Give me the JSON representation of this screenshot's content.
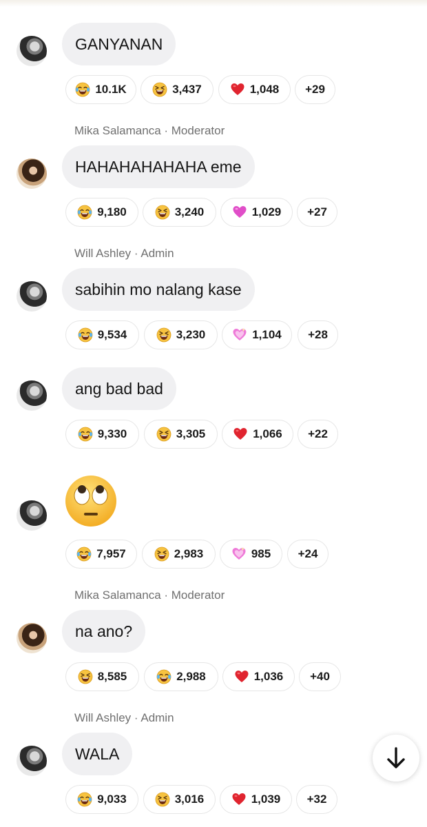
{
  "messages": [
    {
      "sender": "",
      "text": "GANYANAN",
      "avatar": "male",
      "reactions": [
        {
          "icon": "laughing-tears-icon",
          "count": "10.1K"
        },
        {
          "icon": "grinning-squint-icon",
          "count": "3,437"
        },
        {
          "icon": "red-heart-icon",
          "count": "1,048"
        },
        {
          "icon": "",
          "count": "+29"
        }
      ]
    },
    {
      "sender": "Mika Salamanca · Moderator",
      "text": "HAHAHAHAHAHA eme",
      "avatar": "female",
      "reactions": [
        {
          "icon": "laughing-tears-icon",
          "count": "9,180"
        },
        {
          "icon": "grinning-squint-icon",
          "count": "3,240"
        },
        {
          "icon": "pink-heart-icon",
          "count": "1,029"
        },
        {
          "icon": "",
          "count": "+27"
        }
      ]
    },
    {
      "sender": "Will Ashley · Admin",
      "text": "sabihin mo nalang kase",
      "avatar": "male",
      "reactions": [
        {
          "icon": "laughing-tears-icon",
          "count": "9,534"
        },
        {
          "icon": "grinning-squint-icon",
          "count": "3,230"
        },
        {
          "icon": "sparkling-heart-icon",
          "count": "1,104"
        },
        {
          "icon": "",
          "count": "+28"
        }
      ]
    },
    {
      "sender": "",
      "text": "ang bad bad",
      "avatar": "male",
      "reactions": [
        {
          "icon": "laughing-tears-icon",
          "count": "9,330"
        },
        {
          "icon": "grinning-squint-icon",
          "count": "3,305"
        },
        {
          "icon": "red-heart-icon",
          "count": "1,066"
        },
        {
          "icon": "",
          "count": "+22"
        }
      ]
    },
    {
      "sender": "",
      "text": "",
      "emoji": "eye-roll-emoji-icon",
      "avatar": "male",
      "reactions": [
        {
          "icon": "laughing-tears-icon",
          "count": "7,957"
        },
        {
          "icon": "grinning-squint-icon",
          "count": "2,983"
        },
        {
          "icon": "sparkling-heart-icon",
          "count": "985"
        },
        {
          "icon": "",
          "count": "+24"
        }
      ]
    },
    {
      "sender": "Mika Salamanca · Moderator",
      "text": "na ano?",
      "avatar": "female",
      "reactions": [
        {
          "icon": "grinning-squint-icon",
          "count": "8,585"
        },
        {
          "icon": "laughing-tears-icon",
          "count": "2,988"
        },
        {
          "icon": "red-heart-icon",
          "count": "1,036"
        },
        {
          "icon": "",
          "count": "+40"
        }
      ]
    },
    {
      "sender": "Will Ashley · Admin",
      "text": "WALA",
      "avatar": "male",
      "reactions": [
        {
          "icon": "laughing-tears-icon",
          "count": "9,033"
        },
        {
          "icon": "grinning-squint-icon",
          "count": "3,016"
        },
        {
          "icon": "red-heart-icon",
          "count": "1,039"
        },
        {
          "icon": "",
          "count": "+32"
        }
      ]
    }
  ],
  "colors": {
    "bubble": "#f0f0f2",
    "sender_text": "#6f6f6f",
    "red_heart": "#e0242f",
    "pink_heart": "#e04ec8",
    "emoji_yellow": "#f7c340"
  },
  "scroll_button": {
    "icon": "arrow-down-icon"
  }
}
